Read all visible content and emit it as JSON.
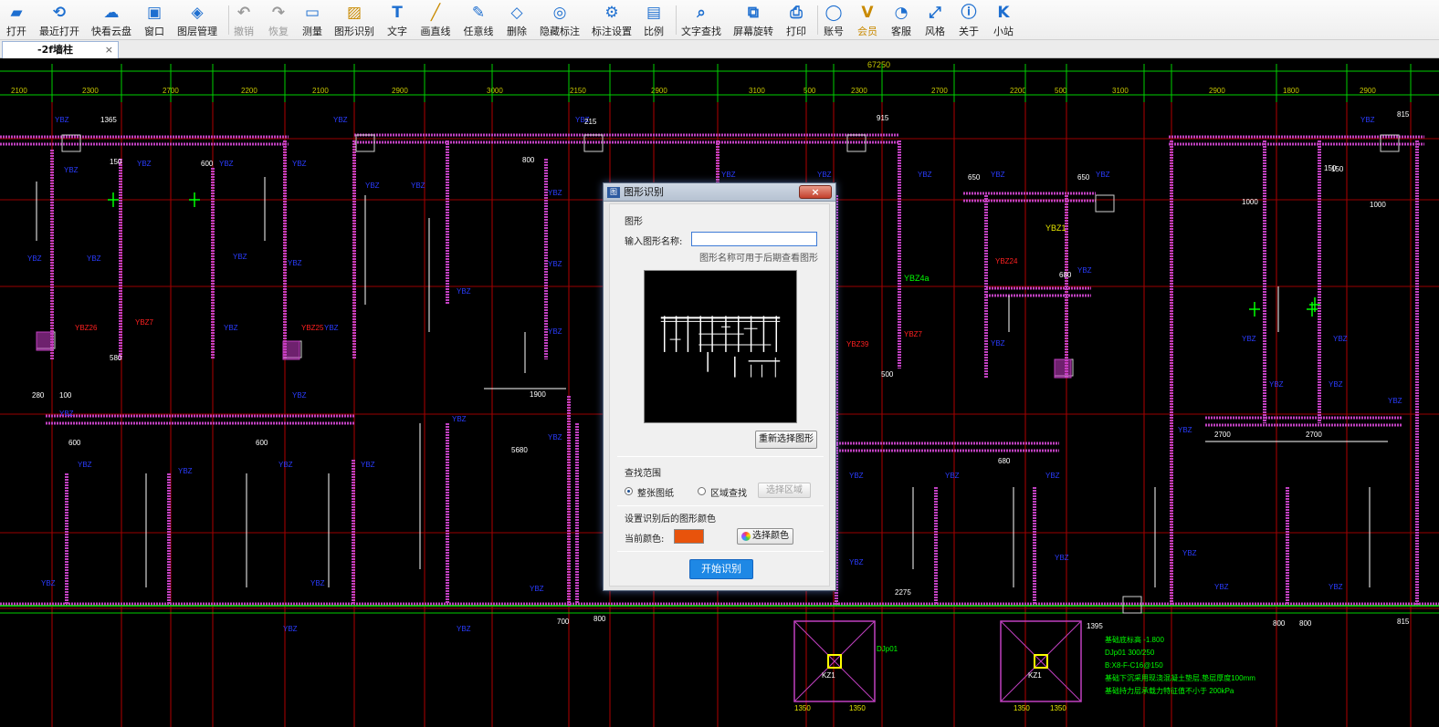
{
  "toolbar": {
    "items": [
      {
        "label": "打开",
        "icon": "folder-open-icon"
      },
      {
        "label": "最近打开",
        "icon": "recent-clock-icon"
      },
      {
        "label": "快看云盘",
        "icon": "cloud-icon"
      },
      {
        "label": "窗口",
        "icon": "window-icon"
      },
      {
        "label": "图层管理",
        "icon": "layers-icon"
      },
      {
        "label": "撤销",
        "icon": "undo-icon"
      },
      {
        "label": "恢复",
        "icon": "redo-icon"
      },
      {
        "label": "测量",
        "icon": "ruler-icon"
      },
      {
        "label": "图形识别",
        "icon": "image-recognize-icon"
      },
      {
        "label": "文字",
        "icon": "text-icon"
      },
      {
        "label": "画直线",
        "icon": "line-icon"
      },
      {
        "label": "任意线",
        "icon": "pen-icon"
      },
      {
        "label": "删除",
        "icon": "eraser-icon"
      },
      {
        "label": "隐藏标注",
        "icon": "eye-hide-icon"
      },
      {
        "label": "标注设置",
        "icon": "annotation-settings-icon"
      },
      {
        "label": "比例",
        "icon": "scale-icon"
      },
      {
        "label": "文字查找",
        "icon": "text-search-icon"
      },
      {
        "label": "屏幕旋转",
        "icon": "rotate-screen-icon"
      },
      {
        "label": "打印",
        "icon": "printer-icon"
      },
      {
        "label": "账号",
        "icon": "user-icon"
      },
      {
        "label": "会员",
        "icon": "vip-icon"
      },
      {
        "label": "客服",
        "icon": "headset-icon"
      },
      {
        "label": "风格",
        "icon": "style-icon"
      },
      {
        "label": "关于",
        "icon": "info-icon"
      },
      {
        "label": "小站",
        "icon": "k-logo-icon"
      }
    ]
  },
  "tab": {
    "title": "-2f墙柱",
    "close": "×"
  },
  "drawing": {
    "overall_dim": "67250",
    "top_dims": [
      "2100",
      "2300",
      "2700",
      "2200",
      "2100",
      "2900",
      "3000",
      "2150",
      "2900",
      "3100",
      "500",
      "2300",
      "2700",
      "2200",
      "500",
      "3100",
      "2900",
      "1800",
      "2900"
    ],
    "labels_red": [
      "YBZ26",
      "YBZ7",
      "YBZ25",
      "YBZ24",
      "YBZ39",
      "YBZ7"
    ],
    "labels_yellow": [
      "YBZ1"
    ],
    "labels_green": [
      "YBZ4a"
    ],
    "footing_label": "KZ1",
    "footing_tag": "DJp01",
    "notes": [
      "基础底标高 -1.800",
      "DJp01 300/250",
      "B:X8-F-C16@150",
      "基础下沉采用现浇混凝土垫层,垫层厚度100mm",
      "基础持力层承载力特征值不小于 200kPa"
    ]
  },
  "dialog": {
    "title": "图形识别",
    "close": "×",
    "section_shape": "图形",
    "name_label": "输入图形名称:",
    "name_value": "",
    "name_hint": "图形名称可用于后期查看图形",
    "reselect_btn": "重新选择图形",
    "section_scope": "查找范围",
    "scope_whole": "整张图纸",
    "scope_area": "区域查找",
    "select_area_btn": "选择区域",
    "section_color": "设置识别后的图形颜色",
    "current_color_label": "当前颜色:",
    "current_color": "#e8530c",
    "choose_color_btn": "选择颜色",
    "start_btn": "开始识别"
  },
  "colors": {
    "wall": "#c040c0",
    "dim": "#00d000",
    "label_blue": "#2a3cff",
    "label_red": "#ff2020",
    "axis_red": "#c00000",
    "accent": "#1e88e5"
  }
}
